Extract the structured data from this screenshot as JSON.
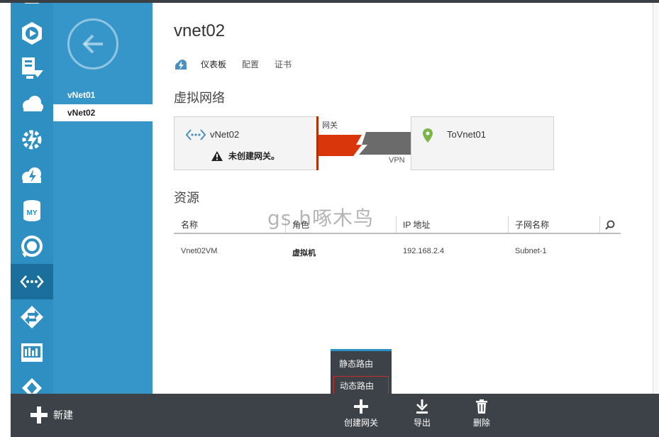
{
  "nav": {
    "items": [
      {
        "label": "vNet01",
        "selected": false
      },
      {
        "label": "vNet02",
        "selected": true
      }
    ]
  },
  "rail": {
    "icons": [
      "media-services-icon",
      "import-export-icon",
      "cloud-services-icon",
      "automation-icon",
      "hdinsight-icon",
      "mysql-icon",
      "recovery-services-icon",
      "networks-icon",
      "traffic-manager-icon",
      "management-services-icon",
      "active-directory-icon"
    ],
    "active_icon": "networks-icon",
    "mysql_label": "MY"
  },
  "main": {
    "title": "vnet02",
    "tabs": [
      {
        "label": "仪表板",
        "current": true
      },
      {
        "label": "配置",
        "current": false
      },
      {
        "label": "证书",
        "current": false
      }
    ],
    "network_section_title": "虚拟网络",
    "local_network": {
      "name": "vNet02",
      "warning": "未创建网关。"
    },
    "gateway_label": "网关",
    "vpn_label": "VPN",
    "remote_network": {
      "name": "ToVnet01"
    },
    "resources_title": "资源",
    "table": {
      "columns": [
        "名称",
        "角色",
        "IP 地址",
        "子网名称"
      ],
      "rows": [
        [
          "Vnet02VM",
          "虚拟机",
          "192.168.2.4",
          "Subnet-1"
        ]
      ]
    }
  },
  "watermark": "gs.h啄木鸟",
  "popup_menu": {
    "items": [
      {
        "label": "静态路由",
        "highlighted": false
      },
      {
        "label": "动态路由",
        "highlighted": true
      }
    ]
  },
  "cmdbar": {
    "new_label": "新建",
    "create_gateway_label": "创建网关",
    "export_label": "导出",
    "delete_label": "删除"
  },
  "colors": {
    "rail_bg": "#2e8fc3",
    "nav_bg": "#3696c9",
    "gateway_red": "#d9370b",
    "vpn_gray": "#6b6b6b",
    "cmdbar_bg": "#3d4248"
  }
}
